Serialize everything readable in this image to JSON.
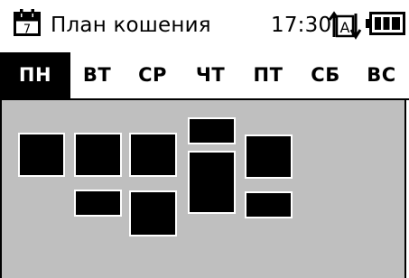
{
  "header": {
    "calendar_day": "7",
    "title": "План кошения",
    "time": "17:30",
    "mode_letter": "A",
    "icons": [
      "calendar-icon",
      "auto-mode-icon",
      "battery-icon"
    ]
  },
  "tabs": [
    {
      "label": "ПН",
      "active": true
    },
    {
      "label": "ВТ",
      "active": false
    },
    {
      "label": "СР",
      "active": false
    },
    {
      "label": "ЧТ",
      "active": false
    },
    {
      "label": "ПТ",
      "active": false
    },
    {
      "label": "СБ",
      "active": false
    },
    {
      "label": "ВС",
      "active": false
    }
  ],
  "colors": {
    "background": "#ffffff",
    "schedule_background": "#bfbfbf",
    "slot": "#000000",
    "active_tab": "#000000"
  }
}
